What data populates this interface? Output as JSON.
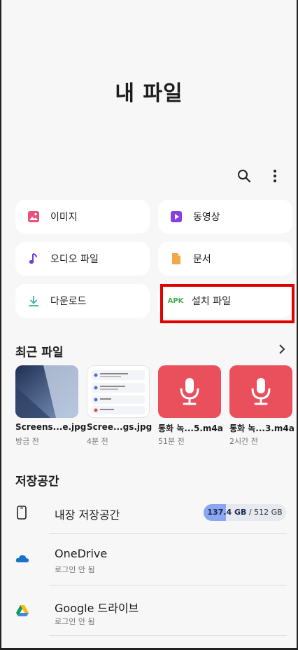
{
  "header": {
    "title": "내 파일"
  },
  "toolbar": {
    "search_icon": "search-icon",
    "more_icon": "more-vert-icon"
  },
  "categories": [
    {
      "label": "이미지",
      "icon": "image-icon",
      "color": "#e8517a"
    },
    {
      "label": "동영상",
      "icon": "video-icon",
      "color": "#8a3fe0"
    },
    {
      "label": "오디오 파일",
      "icon": "music-note-icon",
      "color": "#6a3fd6"
    },
    {
      "label": "문서",
      "icon": "document-icon",
      "color": "#f0a84b"
    },
    {
      "label": "다운로드",
      "icon": "download-icon",
      "color": "#3fb39a"
    },
    {
      "label": "설치 파일",
      "icon": "apk-icon",
      "badge": "APK",
      "color": "#46b04a"
    }
  ],
  "recent": {
    "title": "최근 파일",
    "files": [
      {
        "name": "Screens...e.jpg",
        "time": "방금 전",
        "type": "image"
      },
      {
        "name": "Scree...gs.jpg",
        "time": "4분 전",
        "type": "screenshot"
      },
      {
        "name": "통화 녹...5.m4a",
        "time": "51분 전",
        "type": "audio"
      },
      {
        "name": "통화 녹...3.m4a",
        "time": "2시간 전",
        "type": "audio"
      }
    ]
  },
  "storage": {
    "title": "저장공간",
    "internal": {
      "label": "내장 저장공간",
      "used": "137.4 GB",
      "total": "/ 512 GB",
      "used_fraction": 0.268
    },
    "onedrive": {
      "label": "OneDrive",
      "status": "로그인 안 됨"
    },
    "gdrive": {
      "label": "Google 드라이브",
      "status": "로그인 안 됨"
    }
  }
}
